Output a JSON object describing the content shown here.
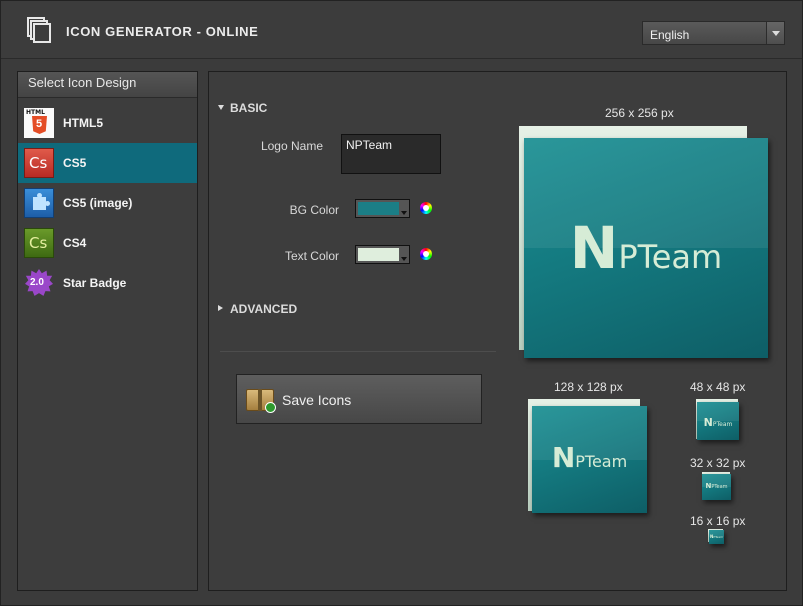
{
  "header": {
    "title": "ICON GENERATOR - ONLINE",
    "language": "English"
  },
  "sidebar": {
    "title": "Select Icon Design",
    "items": [
      {
        "label": "HTML5",
        "icon": "html5-icon",
        "icon_text": "HTML",
        "icon_glyph": "5",
        "active": false
      },
      {
        "label": "CS5",
        "icon": "cs5-icon",
        "icon_glyph": "Cs",
        "active": true
      },
      {
        "label": "CS5 (image)",
        "icon": "puzzle-icon",
        "active": false
      },
      {
        "label": "CS4",
        "icon": "cs4-icon",
        "icon_glyph": "Cs",
        "active": false
      },
      {
        "label": "Star Badge",
        "icon": "star-badge-icon",
        "icon_glyph": "2.0",
        "active": false
      }
    ],
    "active_color": "#0f6a7c"
  },
  "settings": {
    "basic_label": "BASIC",
    "advanced_label": "ADVANCED",
    "logo_name_label": "Logo Name",
    "logo_name_value": "NPTeam",
    "bg_color_label": "BG Color",
    "bg_color_value": "#1b7e86",
    "text_color_label": "Text Color",
    "text_color_value": "#dfeedd",
    "save_label": "Save Icons"
  },
  "previews": {
    "logo_first": "N",
    "logo_rest": "PTeam",
    "sizes": [
      "256 x 256 px",
      "128 x 128 px",
      "48 x 48 px",
      "32 x 32 px",
      "16 x 16 px"
    ]
  }
}
